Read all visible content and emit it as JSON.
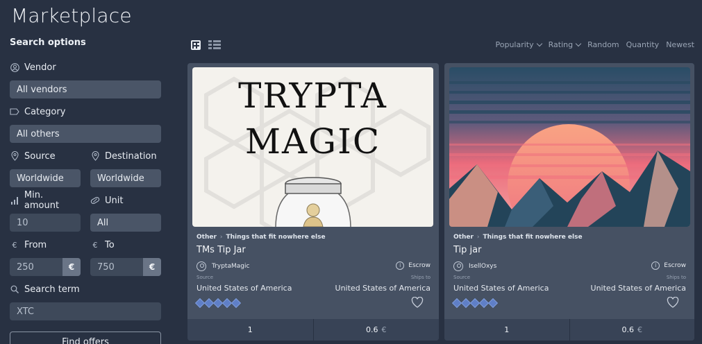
{
  "page": {
    "title": "Marketplace"
  },
  "sidebar": {
    "heading": "Search options",
    "vendor": {
      "label": "Vendor",
      "value": "All vendors"
    },
    "category": {
      "label": "Category",
      "value": "All others"
    },
    "source": {
      "label": "Source",
      "value": "Worldwide"
    },
    "destination": {
      "label": "Destination",
      "value": "Worldwide"
    },
    "min_amount": {
      "label": "Min. amount",
      "placeholder": "10"
    },
    "unit": {
      "label": "Unit",
      "value": "All"
    },
    "from": {
      "label": "From",
      "placeholder": "250",
      "unit": "€"
    },
    "to": {
      "label": "To",
      "placeholder": "750",
      "unit": "€"
    },
    "search_term": {
      "label": "Search term",
      "placeholder": "XTC"
    },
    "find_button": "Find offers"
  },
  "toolbar": {
    "sort": [
      "Popularity",
      "Rating",
      "Random",
      "Quantity",
      "Newest"
    ]
  },
  "cards": [
    {
      "category": "Other",
      "subcategory": "Things that fit nowhere else",
      "title": "TMs Tip Jar",
      "vendor": "TryptaMagic",
      "escrow": "Escrow",
      "source_label": "Source",
      "ships_label": "Ships to",
      "source": "United States of America",
      "ships_to": "United States of America",
      "rating": 5,
      "quantity": "1",
      "price": "0.6",
      "currency": "€",
      "image_text_1": "TRYPTA",
      "image_text_2": "MAGIC"
    },
    {
      "category": "Other",
      "subcategory": "Things that fit nowhere else",
      "title": "Tip jar",
      "vendor": "IsellOxys",
      "escrow": "Escrow",
      "source_label": "Source",
      "ships_label": "Ships to",
      "source": "United States of America",
      "ships_to": "United States of America",
      "rating": 5,
      "quantity": "1",
      "price": "0.6",
      "currency": "€"
    }
  ]
}
